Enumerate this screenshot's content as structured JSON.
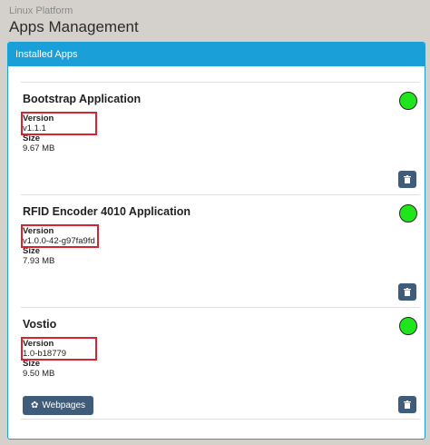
{
  "header": {
    "platform": "Linux Platform",
    "title": "Apps Management"
  },
  "panel": {
    "heading": "Installed Apps"
  },
  "labels": {
    "version": "Version",
    "size": "Size"
  },
  "apps": [
    {
      "name": "Bootstrap Application",
      "version": "v1.1.1",
      "size": "9.67 MB",
      "status": "running"
    },
    {
      "name": "RFID Encoder 4010 Application",
      "version": "v1.0.0-42-g97fa9fd",
      "size": "7.93 MB",
      "status": "running"
    },
    {
      "name": "Vostio",
      "version": "1.0-b18779",
      "size": "9.50 MB",
      "status": "running",
      "webpages_label": "Webpages"
    }
  ],
  "icons": {
    "delete": "trash-icon",
    "webpages": "gear-icon",
    "status": "status-dot"
  },
  "colors": {
    "accent": "#1a9fd8",
    "status_ok": "#1ee61a",
    "highlight": "#d9232f",
    "button": "#3f5d7a"
  }
}
